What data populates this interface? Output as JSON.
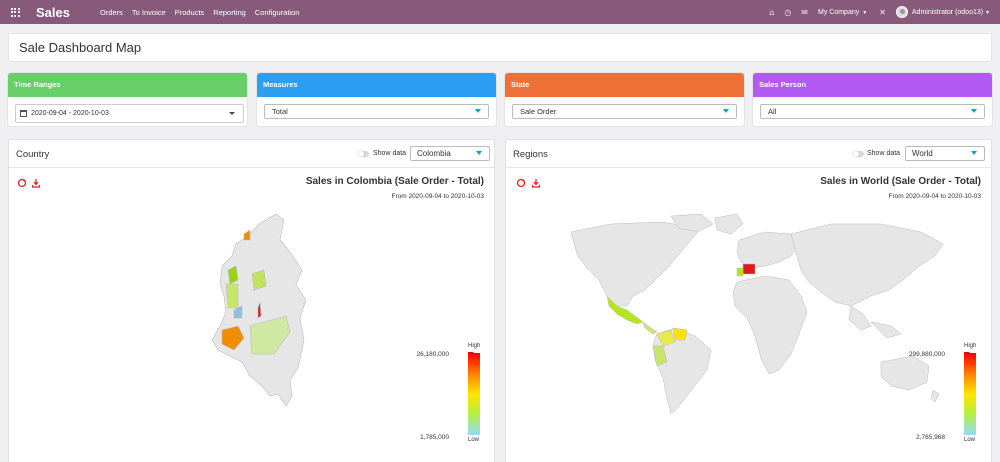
{
  "navbar": {
    "app_name": "Sales",
    "menu": [
      "Orders",
      "To Invoice",
      "Products",
      "Reporting",
      "Configuration"
    ],
    "company": "My Company",
    "user": "Administrator (odoo13)",
    "icons": [
      "apps-icon",
      "home-icon",
      "clock-icon",
      "chat-icon",
      "tools-icon"
    ]
  },
  "page": {
    "title": "Sale Dashboard Map"
  },
  "filters": {
    "time_ranges": {
      "label": "Time Ranges",
      "value": "2020-09-04 - 2020-10-03",
      "color": "#66cf68"
    },
    "measures": {
      "label": "Measures",
      "value": "Total",
      "color": "#2c9ff3"
    },
    "state": {
      "label": "State",
      "value": "Sale Order",
      "color": "#f07138"
    },
    "sales_person": {
      "label": "Sales Person",
      "value": "All",
      "color": "#b25bf3"
    }
  },
  "country_panel": {
    "title": "Country",
    "show_data_label": "Show data",
    "selected": "Colombia",
    "map_title": "Sales in Colombia (Sale Order - Total)",
    "map_subtitle": "From 2020-09-04 to 2020-10-03",
    "legend": {
      "high": "High",
      "low": "Low",
      "max": "26,180,000",
      "min": "1,785,000"
    }
  },
  "regions_panel": {
    "title": "Regions",
    "show_data_label": "Show data",
    "selected": "World",
    "map_title": "Sales in World (Sale Order - Total)",
    "map_subtitle": "From 2020-09-04 to 2020-10-03",
    "legend": {
      "high": "High",
      "low": "Low",
      "max": "299,880,000",
      "min": "2,765,968"
    }
  }
}
